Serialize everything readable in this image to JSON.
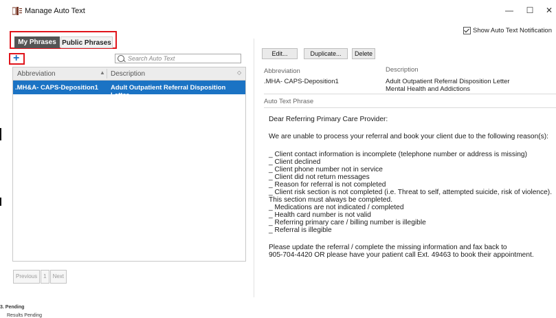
{
  "window": {
    "title": "Manage Auto Text",
    "minimize_glyph": "—",
    "maximize_glyph": "☐",
    "close_glyph": "✕"
  },
  "notification": {
    "label": "Show Auto Text Notification",
    "checked": true
  },
  "tabs": [
    {
      "label": "My Phrases",
      "active": true
    },
    {
      "label": "Public Phrases",
      "active": false
    }
  ],
  "add_button": {
    "glyph": "+"
  },
  "search": {
    "placeholder": "Search Auto Text"
  },
  "list": {
    "columns": [
      "Abbreviation",
      "Description"
    ],
    "sort_glyphs": [
      "▲",
      "◇"
    ],
    "rows": [
      {
        "abbreviation": ".MH&A- CAPS-Deposition1",
        "description": "Adult Outpatient Referral Disposition Letter..."
      }
    ]
  },
  "pager": {
    "previous": "Previous",
    "page": "1",
    "next": "Next"
  },
  "toolbar": {
    "edit": "Edit...",
    "duplicate": "Duplicate...",
    "delete": "Delete"
  },
  "details": {
    "abbreviation_label": "Abbreviation",
    "abbreviation_value": ".MHA- CAPS-Deposition1",
    "description_label": "Description",
    "description_line1": "Adult Outpatient Referral Disposition Letter",
    "description_line2": "Mental Health and Addictions",
    "phrase_label": "Auto Text Phrase"
  },
  "phrase": {
    "greeting": "Dear Referring Primary Care Provider:",
    "intro": "We are unable to process your referral and book your client due to the following reason(s):",
    "reasons": [
      "_ Client contact information is incomplete (telephone number or address is missing)",
      "_ Client declined",
      "_ Client phone number not in service",
      "_ Client did not return messages",
      "_ Reason for referral is not completed",
      "_ Client risk section is not completed (i.e. Threat to self, attempted suicide, risk of violence).",
      "This section must always be completed.",
      "_ Medications are not indicated / completed",
      "_ Health card number is not valid",
      "_ Referring primary care / billing number is illegible",
      "_ Referral is illegible"
    ],
    "closing1": "Please update the referral / complete the missing information and fax back to",
    "closing2": "905-704-4420 OR please have your patient call Ext. 49463 to book their appointment."
  },
  "background": {
    "line1": "3. Pending",
    "line2": "Results Pending"
  }
}
